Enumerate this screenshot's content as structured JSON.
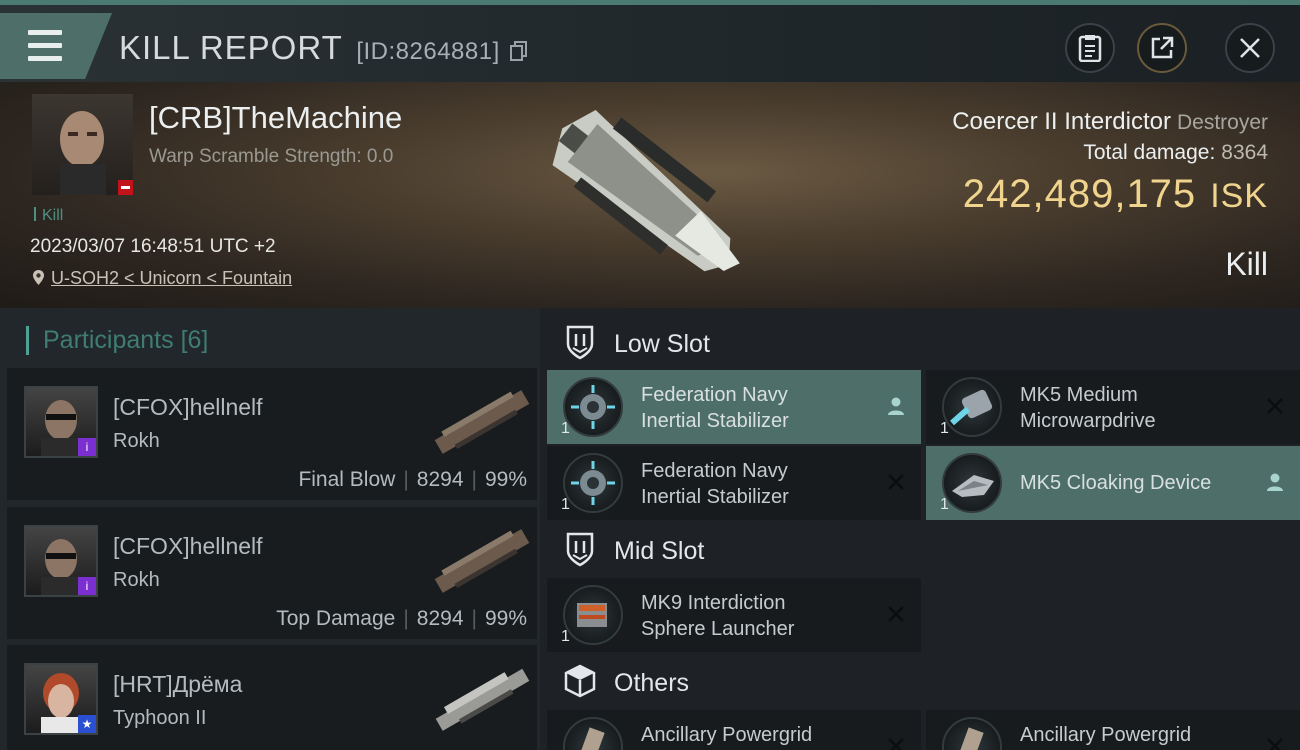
{
  "header": {
    "title": "KILL REPORT",
    "id": "[ID:8264881]"
  },
  "victim": {
    "name": "[CRB]TheMachine",
    "warp_scramble": "Warp Scramble Strength: 0.0",
    "kill_tag": "Kill",
    "time": "2023/03/07 16:48:51 UTC +2",
    "location": "U-SOH2 < Unicorn < Fountain"
  },
  "ship": {
    "name": "Coercer II Interdictor",
    "class": "Destroyer",
    "total_damage_label": "Total damage:",
    "total_damage": "8364",
    "isk_value": "242,489,175",
    "isk_unit": "ISK",
    "result": "Kill"
  },
  "participants": {
    "title": "Participants",
    "count": "[6]",
    "items": [
      {
        "name": "[CFOX]hellnelf",
        "ship": "Rokh",
        "role": "Final Blow",
        "damage": "8294",
        "percent": "99%"
      },
      {
        "name": "[CFOX]hellnelf",
        "ship": "Rokh",
        "role": "Top Damage",
        "damage": "8294",
        "percent": "99%"
      },
      {
        "name": "[HRT]Дрёма",
        "ship": "Typhoon II",
        "role": "",
        "damage": "",
        "percent": ""
      }
    ]
  },
  "slots": {
    "low": {
      "title": "Low Slot",
      "items": [
        {
          "line1": "Federation Navy",
          "line2": "Inertial Stabilizer",
          "qty": "1",
          "status": "dropped"
        },
        {
          "line1": "MK5 Medium",
          "line2": "Microwarpdrive",
          "qty": "1",
          "status": "destroyed"
        },
        {
          "line1": "Federation Navy",
          "line2": "Inertial Stabilizer",
          "qty": "1",
          "status": "destroyed"
        },
        {
          "line1": "MK5 Cloaking Device",
          "line2": "",
          "qty": "1",
          "status": "dropped"
        }
      ]
    },
    "mid": {
      "title": "Mid Slot",
      "items": [
        {
          "line1": "MK9 Interdiction",
          "line2": "Sphere Launcher",
          "qty": "1",
          "status": "destroyed"
        }
      ]
    },
    "others": {
      "title": "Others",
      "items": [
        {
          "line1": "Ancillary Powergrid",
          "line2": "",
          "qty": "",
          "status": "destroyed"
        },
        {
          "line1": "Ancillary Powergrid",
          "line2": "",
          "qty": "",
          "status": "destroyed"
        }
      ]
    }
  },
  "icons": {
    "menu": "hamburger-icon",
    "clipboard": "clipboard-icon",
    "share": "share-icon",
    "close": "close-icon",
    "location": "location-pin-icon",
    "dropped": "person-icon",
    "destroyed": "x-icon"
  },
  "colors": {
    "accent": "#4d6e69",
    "isk": "#f0d48e",
    "teal_text": "#3f7c73"
  }
}
